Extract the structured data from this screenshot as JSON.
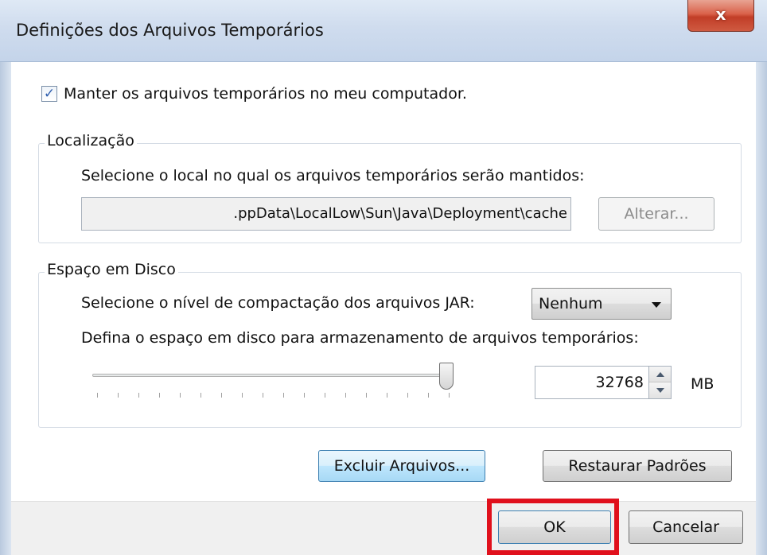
{
  "window": {
    "title": "Definições dos Arquivos Temporários",
    "close_glyph": "x"
  },
  "keep_files": {
    "checked": true,
    "check_glyph": "✓",
    "label": "Manter os arquivos temporários no meu computador."
  },
  "location": {
    "group_label": "Localização",
    "description": "Selecione o local no qual os arquivos temporários serão mantidos:",
    "path_value": ".ppData\\LocalLow\\Sun\\Java\\Deployment\\cache",
    "change_button": "Alterar..."
  },
  "disk_space": {
    "group_label": "Espaço em Disco",
    "compression_label": "Selecione o nível de compactação dos arquivos JAR:",
    "compression_value": "Nenhum",
    "space_label": "Defina o espaço em disco para armazenamento de arquivos temporários:",
    "slider_level": 1.0,
    "space_value": "32768",
    "unit": "MB"
  },
  "actions": {
    "delete_files": "Excluir Arquivos...",
    "restore_defaults": "Restaurar Padrões"
  },
  "footer": {
    "ok": "OK",
    "cancel": "Cancelar"
  },
  "colors": {
    "highlight": "#e0101c",
    "focus": "#3c7fb1"
  }
}
